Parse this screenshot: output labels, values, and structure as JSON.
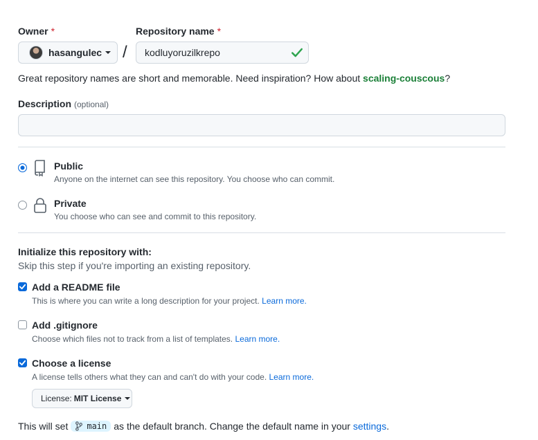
{
  "owner": {
    "label": "Owner",
    "required_mark": "*",
    "value": "hasangulec"
  },
  "repo": {
    "label": "Repository name",
    "required_mark": "*",
    "value": "kodluyoruzilkrepo",
    "separator": "/"
  },
  "hint": {
    "text": "Great repository names are short and memorable. Need inspiration? How about ",
    "suggestion": "scaling-couscous",
    "suffix": "?"
  },
  "description": {
    "label": "Description",
    "optional": "(optional)",
    "value": ""
  },
  "visibility": {
    "public": {
      "title": "Public",
      "subtitle": "Anyone on the internet can see this repository. You choose who can commit.",
      "selected": true
    },
    "private": {
      "title": "Private",
      "subtitle": "You choose who can see and commit to this repository.",
      "selected": false
    }
  },
  "init": {
    "title": "Initialize this repository with:",
    "subtitle": "Skip this step if you're importing an existing repository.",
    "readme": {
      "label": "Add a README file",
      "desc": "This is where you can write a long description for your project.",
      "link": "Learn more.",
      "checked": true
    },
    "gitignore": {
      "label": "Add .gitignore",
      "desc": "Choose which files not to track from a list of templates.",
      "link": "Learn more.",
      "checked": false
    },
    "license": {
      "label": "Choose a license",
      "desc": "A license tells others what they can and can't do with your code.",
      "link": "Learn more.",
      "checked": true
    },
    "license_select": {
      "prefix": "License:",
      "value": "MIT License"
    }
  },
  "branch": {
    "text_before": "This will set",
    "name": "main",
    "text_after": "as the default branch. Change the default name in your",
    "link": "settings",
    "end": "."
  },
  "colors": {
    "accent": "#0969da",
    "success": "#1a7f37",
    "danger": "#cf222e"
  }
}
